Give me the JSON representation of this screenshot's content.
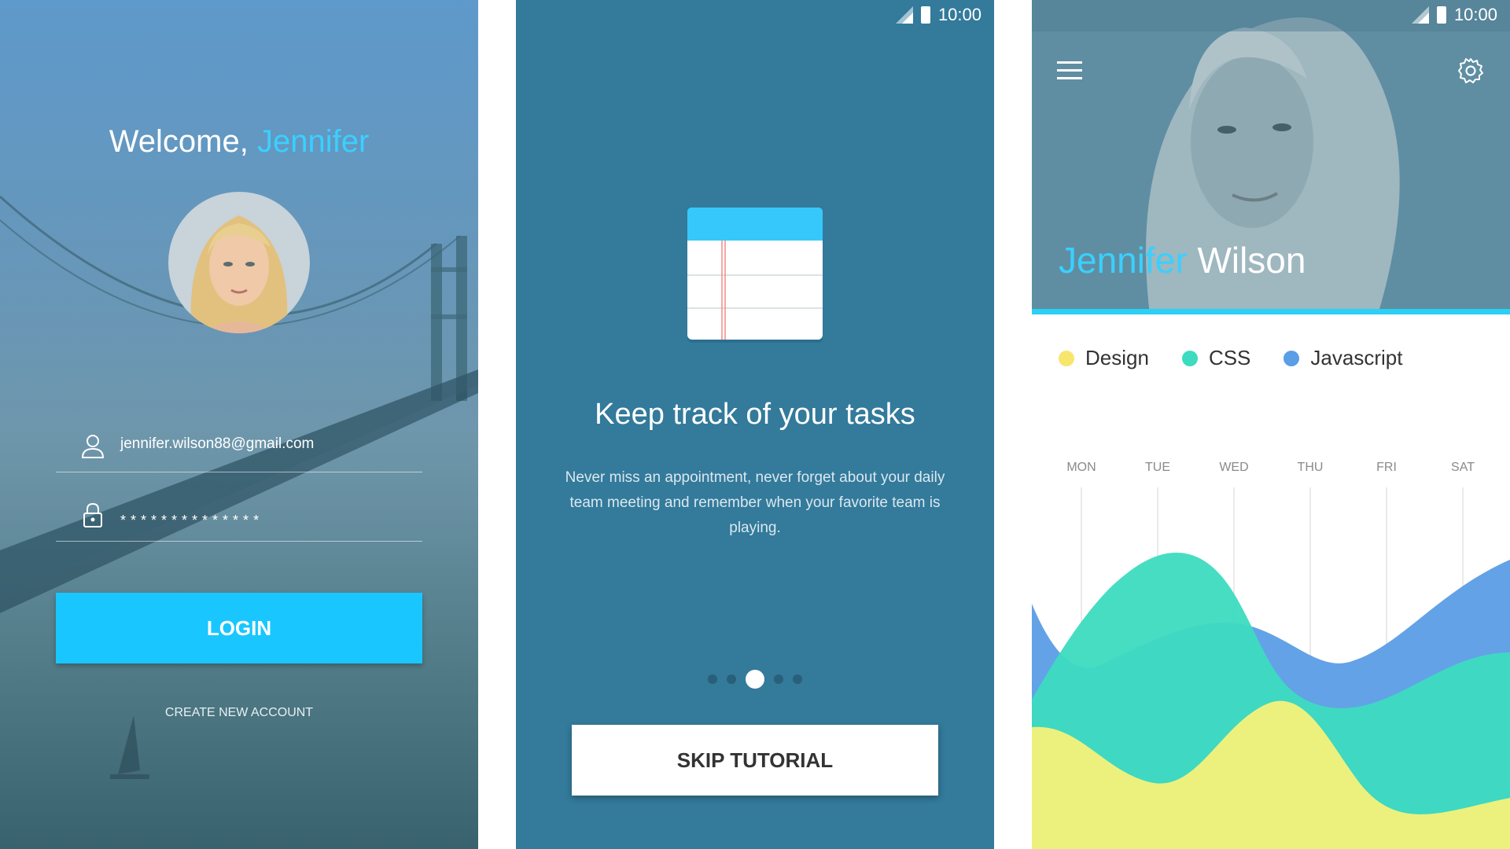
{
  "login": {
    "welcome_prefix": "Welcome,",
    "welcome_name": "Jennifer",
    "email": "jennifer.wilson88@gmail.com",
    "password_mask": "**************",
    "login_label": "LOGIN",
    "create_account_label": "CREATE NEW ACCOUNT",
    "icons": [
      "user-icon",
      "lock-icon"
    ]
  },
  "tutorial": {
    "status_time": "10:00",
    "title": "Keep track of your tasks",
    "body": "Never miss an appointment, never forget about your daily team meeting and remember when your favorite team is playing.",
    "pages": 5,
    "active_page": 3,
    "skip_label": "SKIP TUTORIAL",
    "icon": "notepad-icon"
  },
  "profile": {
    "status_time": "10:00",
    "first_name": "Jennifer",
    "last_name": "Wilson",
    "legend": [
      {
        "label": "Design",
        "color": "#f7e56e"
      },
      {
        "label": "CSS",
        "color": "#3ddbc0"
      },
      {
        "label": "Javascript",
        "color": "#5b9de6"
      }
    ],
    "days": [
      "MON",
      "TUE",
      "WED",
      "THU",
      "FRI",
      "SAT"
    ],
    "icons": [
      "menu-icon",
      "gear-icon"
    ]
  },
  "colors": {
    "accent": "#1ac6ff",
    "tutorial_bg": "#337a9b",
    "hero_bar": "#2bd0f5"
  }
}
